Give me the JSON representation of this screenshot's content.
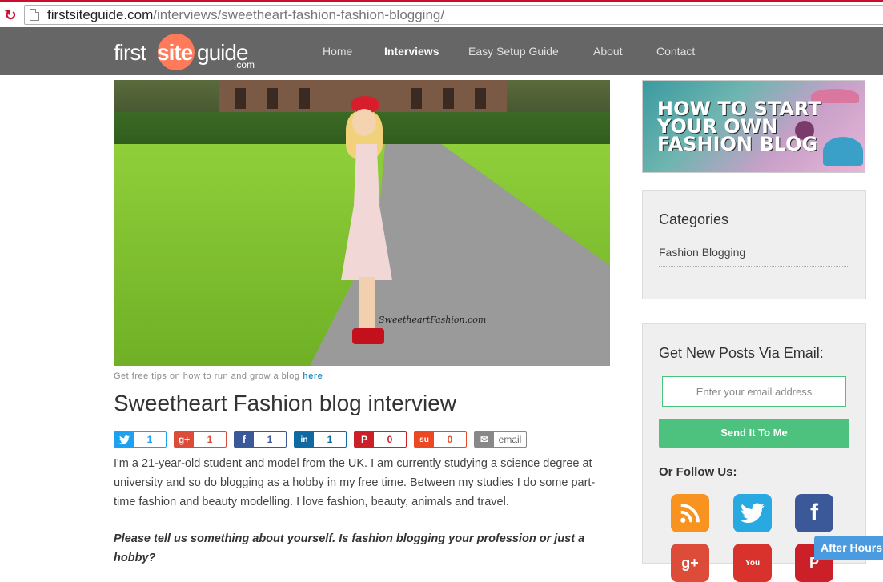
{
  "browser": {
    "url_host": "firstsiteguide.com",
    "url_path": "/interviews/sweetheart-fashion-fashion-blogging/"
  },
  "logo": {
    "first": "first",
    "site": "site",
    "guide": "guide",
    "com": ".com"
  },
  "nav": {
    "items": [
      {
        "label": "Home"
      },
      {
        "label": "Interviews"
      },
      {
        "label": "Easy Setup Guide"
      },
      {
        "label": "About"
      },
      {
        "label": "Contact"
      }
    ],
    "active": "Interviews"
  },
  "hero": {
    "watermark": "SweetheartFashion.com"
  },
  "caption": {
    "text": "Get free tips on how to run and grow a blog ",
    "link": "here"
  },
  "article": {
    "title": "Sweetheart Fashion blog interview",
    "intro": "I'm a 21-year-old student and model from the UK. I am currently studying a science degree at university and so do blogging as a hobby in my free time. Between my studies I do some part-time fashion and beauty modelling. I love fashion, beauty, animals and travel.",
    "question": "Please tell us something about yourself. Is fashion blogging your profession or just a hobby?"
  },
  "shares": [
    {
      "network": "twitter",
      "icon": "twitter-icon",
      "count": "1"
    },
    {
      "network": "googleplus",
      "icon": "google-plus-icon",
      "count": "1"
    },
    {
      "network": "facebook",
      "icon": "facebook-icon",
      "count": "1"
    },
    {
      "network": "linkedin",
      "icon": "linkedin-icon",
      "count": "1"
    },
    {
      "network": "pinterest",
      "icon": "pinterest-icon",
      "count": "0"
    },
    {
      "network": "stumbleupon",
      "icon": "stumbleupon-icon",
      "count": "0"
    },
    {
      "network": "email",
      "icon": "email-icon",
      "count": "email"
    }
  ],
  "sidebar": {
    "banner": {
      "line1": "HOW TO START",
      "line2": "YOUR OWN",
      "line3": "FASHION BLOG"
    },
    "categories": {
      "heading": "Categories",
      "items": [
        "Fashion Blogging"
      ]
    },
    "subscribe": {
      "heading": "Get New Posts Via Email:",
      "email_placeholder": "Enter your email address",
      "button": "Send It To Me",
      "follow": "Or Follow Us:"
    }
  },
  "widget": {
    "after_hours": "After Hours"
  },
  "colors": {
    "nav_bg": "#666666",
    "accent_green": "#4cc27e",
    "logo_orange": "#ff7a59",
    "link_blue": "#2a8bbf"
  }
}
